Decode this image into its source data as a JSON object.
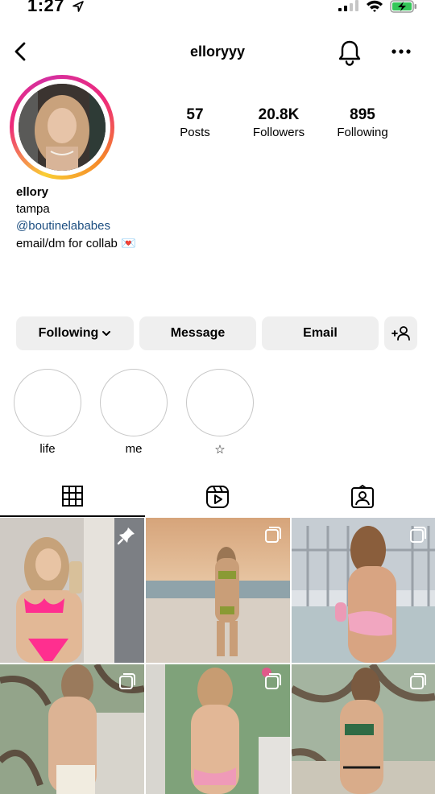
{
  "status_bar": {
    "time": "1:27",
    "icons": [
      "location-arrow-icon",
      "cellular-signal-icon",
      "wifi-icon",
      "battery-charging-icon"
    ]
  },
  "nav": {
    "username": "elloryyy",
    "icons": [
      "back-chevron-icon",
      "bell-icon",
      "more-dots-icon"
    ]
  },
  "stats": {
    "posts_count": "57",
    "posts_label": "Posts",
    "followers_count": "20.8K",
    "followers_label": "Followers",
    "following_count": "895",
    "following_label": "Following"
  },
  "bio": {
    "name": "ellory",
    "location": "tampa",
    "link": "@boutinelababes",
    "text": "email/dm for collab 💌"
  },
  "actions": {
    "following_label": "Following",
    "message_label": "Message",
    "email_label": "Email"
  },
  "highlights": [
    {
      "label": "life"
    },
    {
      "label": "me"
    },
    {
      "label": "☆"
    }
  ],
  "tabs": [
    "grid-icon",
    "reels-icon",
    "tagged-icon"
  ],
  "colors": {
    "link": "#1c4e80",
    "button_bg": "#efefef",
    "battery_green": "#34c759"
  }
}
